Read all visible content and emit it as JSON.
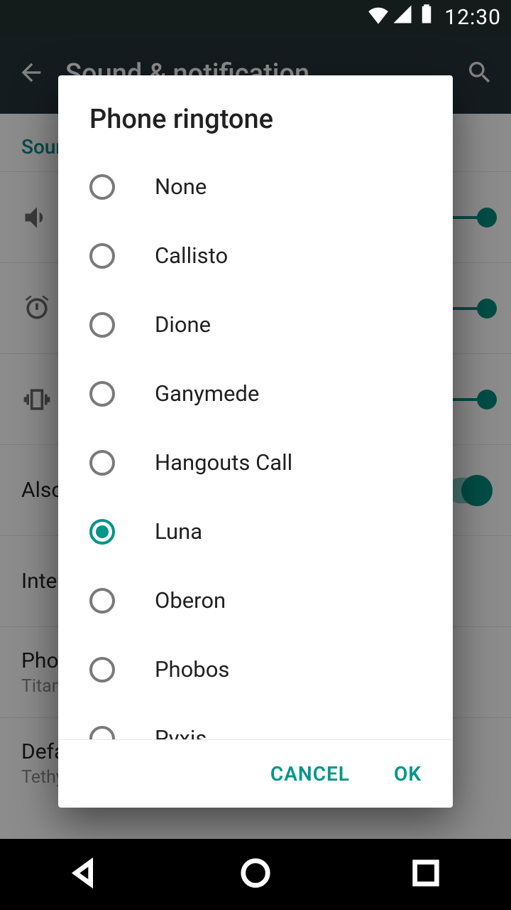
{
  "status": {
    "time": "12:30"
  },
  "background": {
    "appbar_title": "Sound & notification",
    "section_label": "Sound",
    "rows": {
      "also_vibrate": "Also vibrate for calls",
      "interruptions": "Interruptions",
      "phone_ringtone": "Phone ringtone",
      "phone_ringtone_value": "Titania",
      "default_notification": "Default notification ringtone",
      "default_notification_value": "Tethys"
    }
  },
  "dialog": {
    "title": "Phone ringtone",
    "options": [
      {
        "label": "None",
        "selected": false
      },
      {
        "label": "Callisto",
        "selected": false
      },
      {
        "label": "Dione",
        "selected": false
      },
      {
        "label": "Ganymede",
        "selected": false
      },
      {
        "label": "Hangouts Call",
        "selected": false
      },
      {
        "label": "Luna",
        "selected": true
      },
      {
        "label": "Oberon",
        "selected": false
      },
      {
        "label": "Phobos",
        "selected": false
      },
      {
        "label": "Pyxis",
        "selected": false
      }
    ],
    "cancel": "CANCEL",
    "ok": "OK"
  }
}
